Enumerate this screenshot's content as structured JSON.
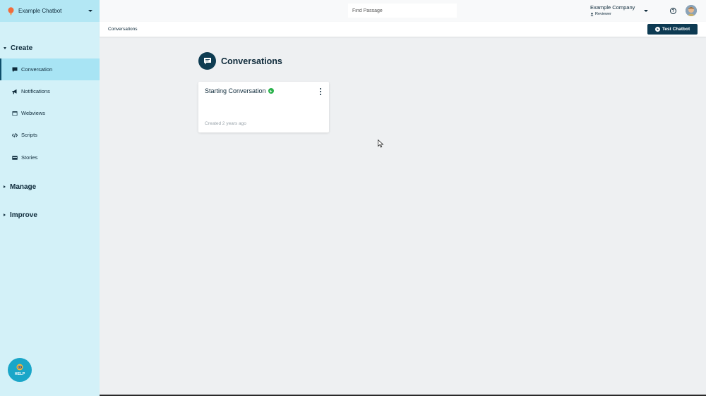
{
  "app": {
    "bot_name": "Example Chatbot",
    "accent": "#b3e7f4",
    "sidebar_bg": "#d3f1f8",
    "primary_dark": "#0d3a52"
  },
  "sidebar": {
    "sections": [
      {
        "label": "Create",
        "expanded": true
      },
      {
        "label": "Manage",
        "expanded": false
      },
      {
        "label": "Improve",
        "expanded": false
      }
    ],
    "items": [
      {
        "label": "Conversation",
        "icon": "chat-bubble-icon",
        "active": true
      },
      {
        "label": "Notifications",
        "icon": "megaphone-icon",
        "active": false
      },
      {
        "label": "Webviews",
        "icon": "window-icon",
        "active": false
      },
      {
        "label": "Scripts",
        "icon": "code-icon",
        "active": false
      },
      {
        "label": "Stories",
        "icon": "card-icon",
        "active": false
      }
    ],
    "help_label": "HELP"
  },
  "topbar": {
    "search_placeholder": "Find Passage",
    "company_name": "Example Company",
    "role": "Reviewer"
  },
  "breadcrumb": {
    "current": "Conversations",
    "test_button": "Test Chatbot"
  },
  "main": {
    "title": "Conversations",
    "cards": [
      {
        "title": "Starting Conversation",
        "status_color": "#2bb24c",
        "meta": "Created 2 years ago"
      }
    ]
  }
}
